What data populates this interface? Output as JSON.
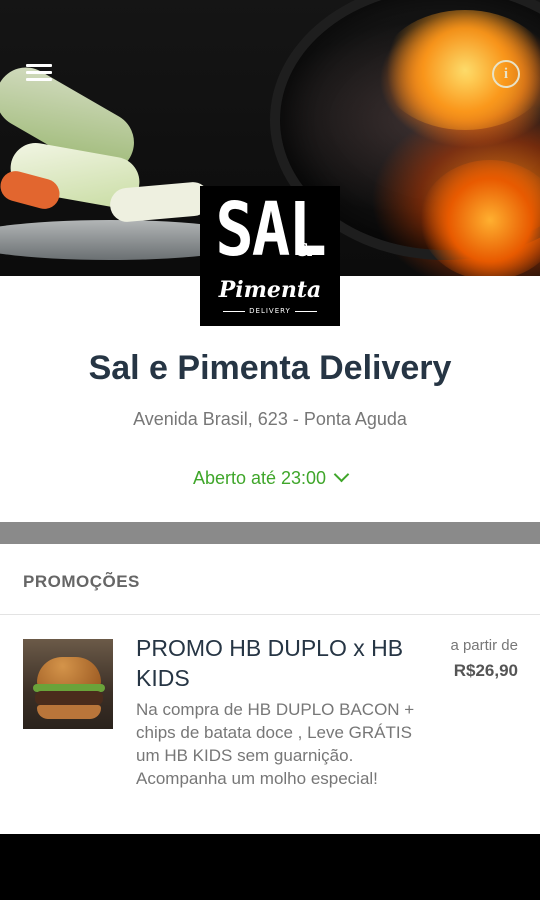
{
  "header": {
    "menu_icon": "hamburger-menu-icon",
    "info_icon": "info-icon",
    "info_glyph": "i"
  },
  "store": {
    "logo": {
      "line1": "SAL",
      "amp": "&",
      "line2": "Pimenta",
      "line3": "DELIVERY"
    },
    "name": "Sal e Pimenta Delivery",
    "address": "Avenida Brasil, 623 - Ponta Aguda",
    "hours": "Aberto até 23:00"
  },
  "promotions": {
    "section_title": "PROMOÇÕES",
    "items": [
      {
        "name": "PROMO HB DUPLO x HB KIDS",
        "description": "Na compra de HB DUPLO BACON + chips de batata doce , Leve GRÁTIS um HB KIDS sem guarnição.  Acompanha um molho especial!",
        "price_prefix": "a partir de",
        "price": "R$26,90"
      }
    ]
  },
  "colors": {
    "title": "#263544",
    "open_status": "#3fa62a",
    "divider": "#8a8a8a"
  }
}
